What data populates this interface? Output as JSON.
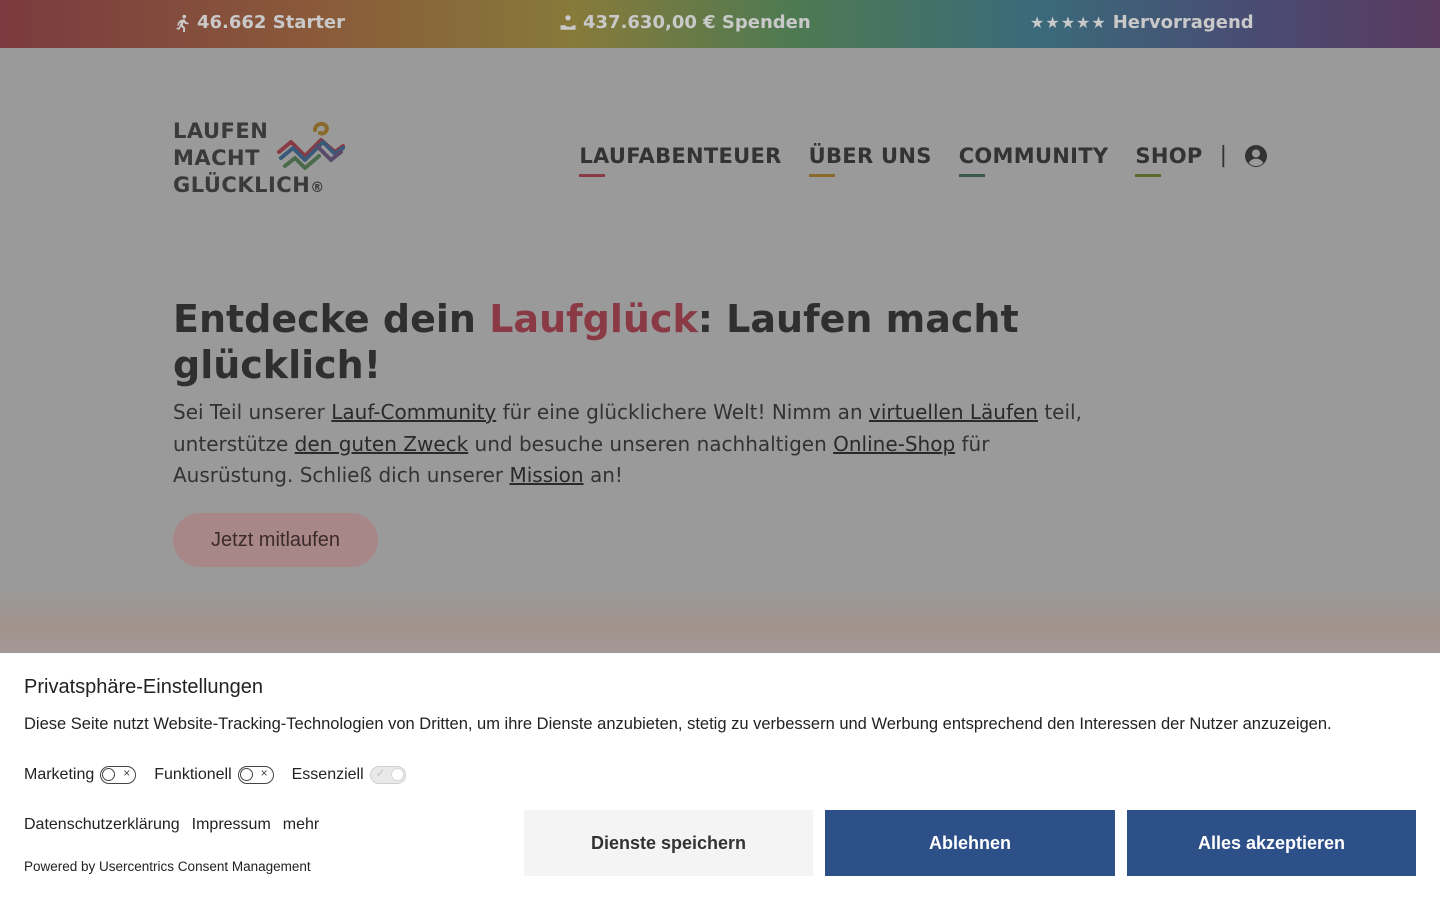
{
  "stats": {
    "starters": "46.662 Starter",
    "donations": "437.630,00 € Spenden",
    "rating_stars": "★★★★★",
    "rating_text": "Hervorragend"
  },
  "logo": {
    "line1": "LAUFEN",
    "line2": "MACHT",
    "line3": "GLÜCKLICH",
    "reg": "®"
  },
  "nav": {
    "items": [
      "LAUFABENTEUER",
      "ÜBER UNS",
      "COMMUNITY",
      "SHOP"
    ],
    "separator": "|",
    "underline_colors": [
      "#8a3a44",
      "#8a6a2a",
      "#3a5a4a",
      "#5a6a2a"
    ]
  },
  "hero": {
    "title_before": "Entdecke dein ",
    "title_accent": "Laufglück",
    "title_after": ": Laufen macht glücklich!",
    "accent_color": "#8a3a44",
    "lead_1": "Sei Teil unserer ",
    "link_community": "Lauf-Community",
    "lead_2": " für eine glücklichere Welt! Nimm an ",
    "link_virtual": "virtuellen Läufen",
    "lead_3": " teil, unterstütze ",
    "link_cause": "den guten Zweck",
    "lead_4": " und besuche unseren nachhaltigen ",
    "link_shop": "Online-Shop",
    "lead_5": " für Ausrüstung. Schließ dich unserer ",
    "link_mission": "Mission",
    "lead_6": " an!",
    "cta": "Jetzt mitlaufen"
  },
  "consent": {
    "title": "Privatsphäre-Einstellungen",
    "text": "Diese Seite nutzt Website-Tracking-Technologien von Dritten, um ihre Dienste anzubieten, stetig zu verbessern und Werbung entsprechend den Interessen der Nutzer anzuzeigen.",
    "toggles": [
      {
        "label": "Marketing",
        "enabled": false
      },
      {
        "label": "Funktionell",
        "enabled": false
      },
      {
        "label": "Essenziell",
        "enabled": true
      }
    ],
    "links": [
      "Datenschutzerklärung",
      "Impressum",
      "mehr"
    ],
    "powered": "Powered by Usercentrics Consent Management",
    "btn_save": "Dienste speichern",
    "btn_deny": "Ablehnen",
    "btn_accept": "Alles akzeptieren",
    "button_color": "#2d5088"
  }
}
